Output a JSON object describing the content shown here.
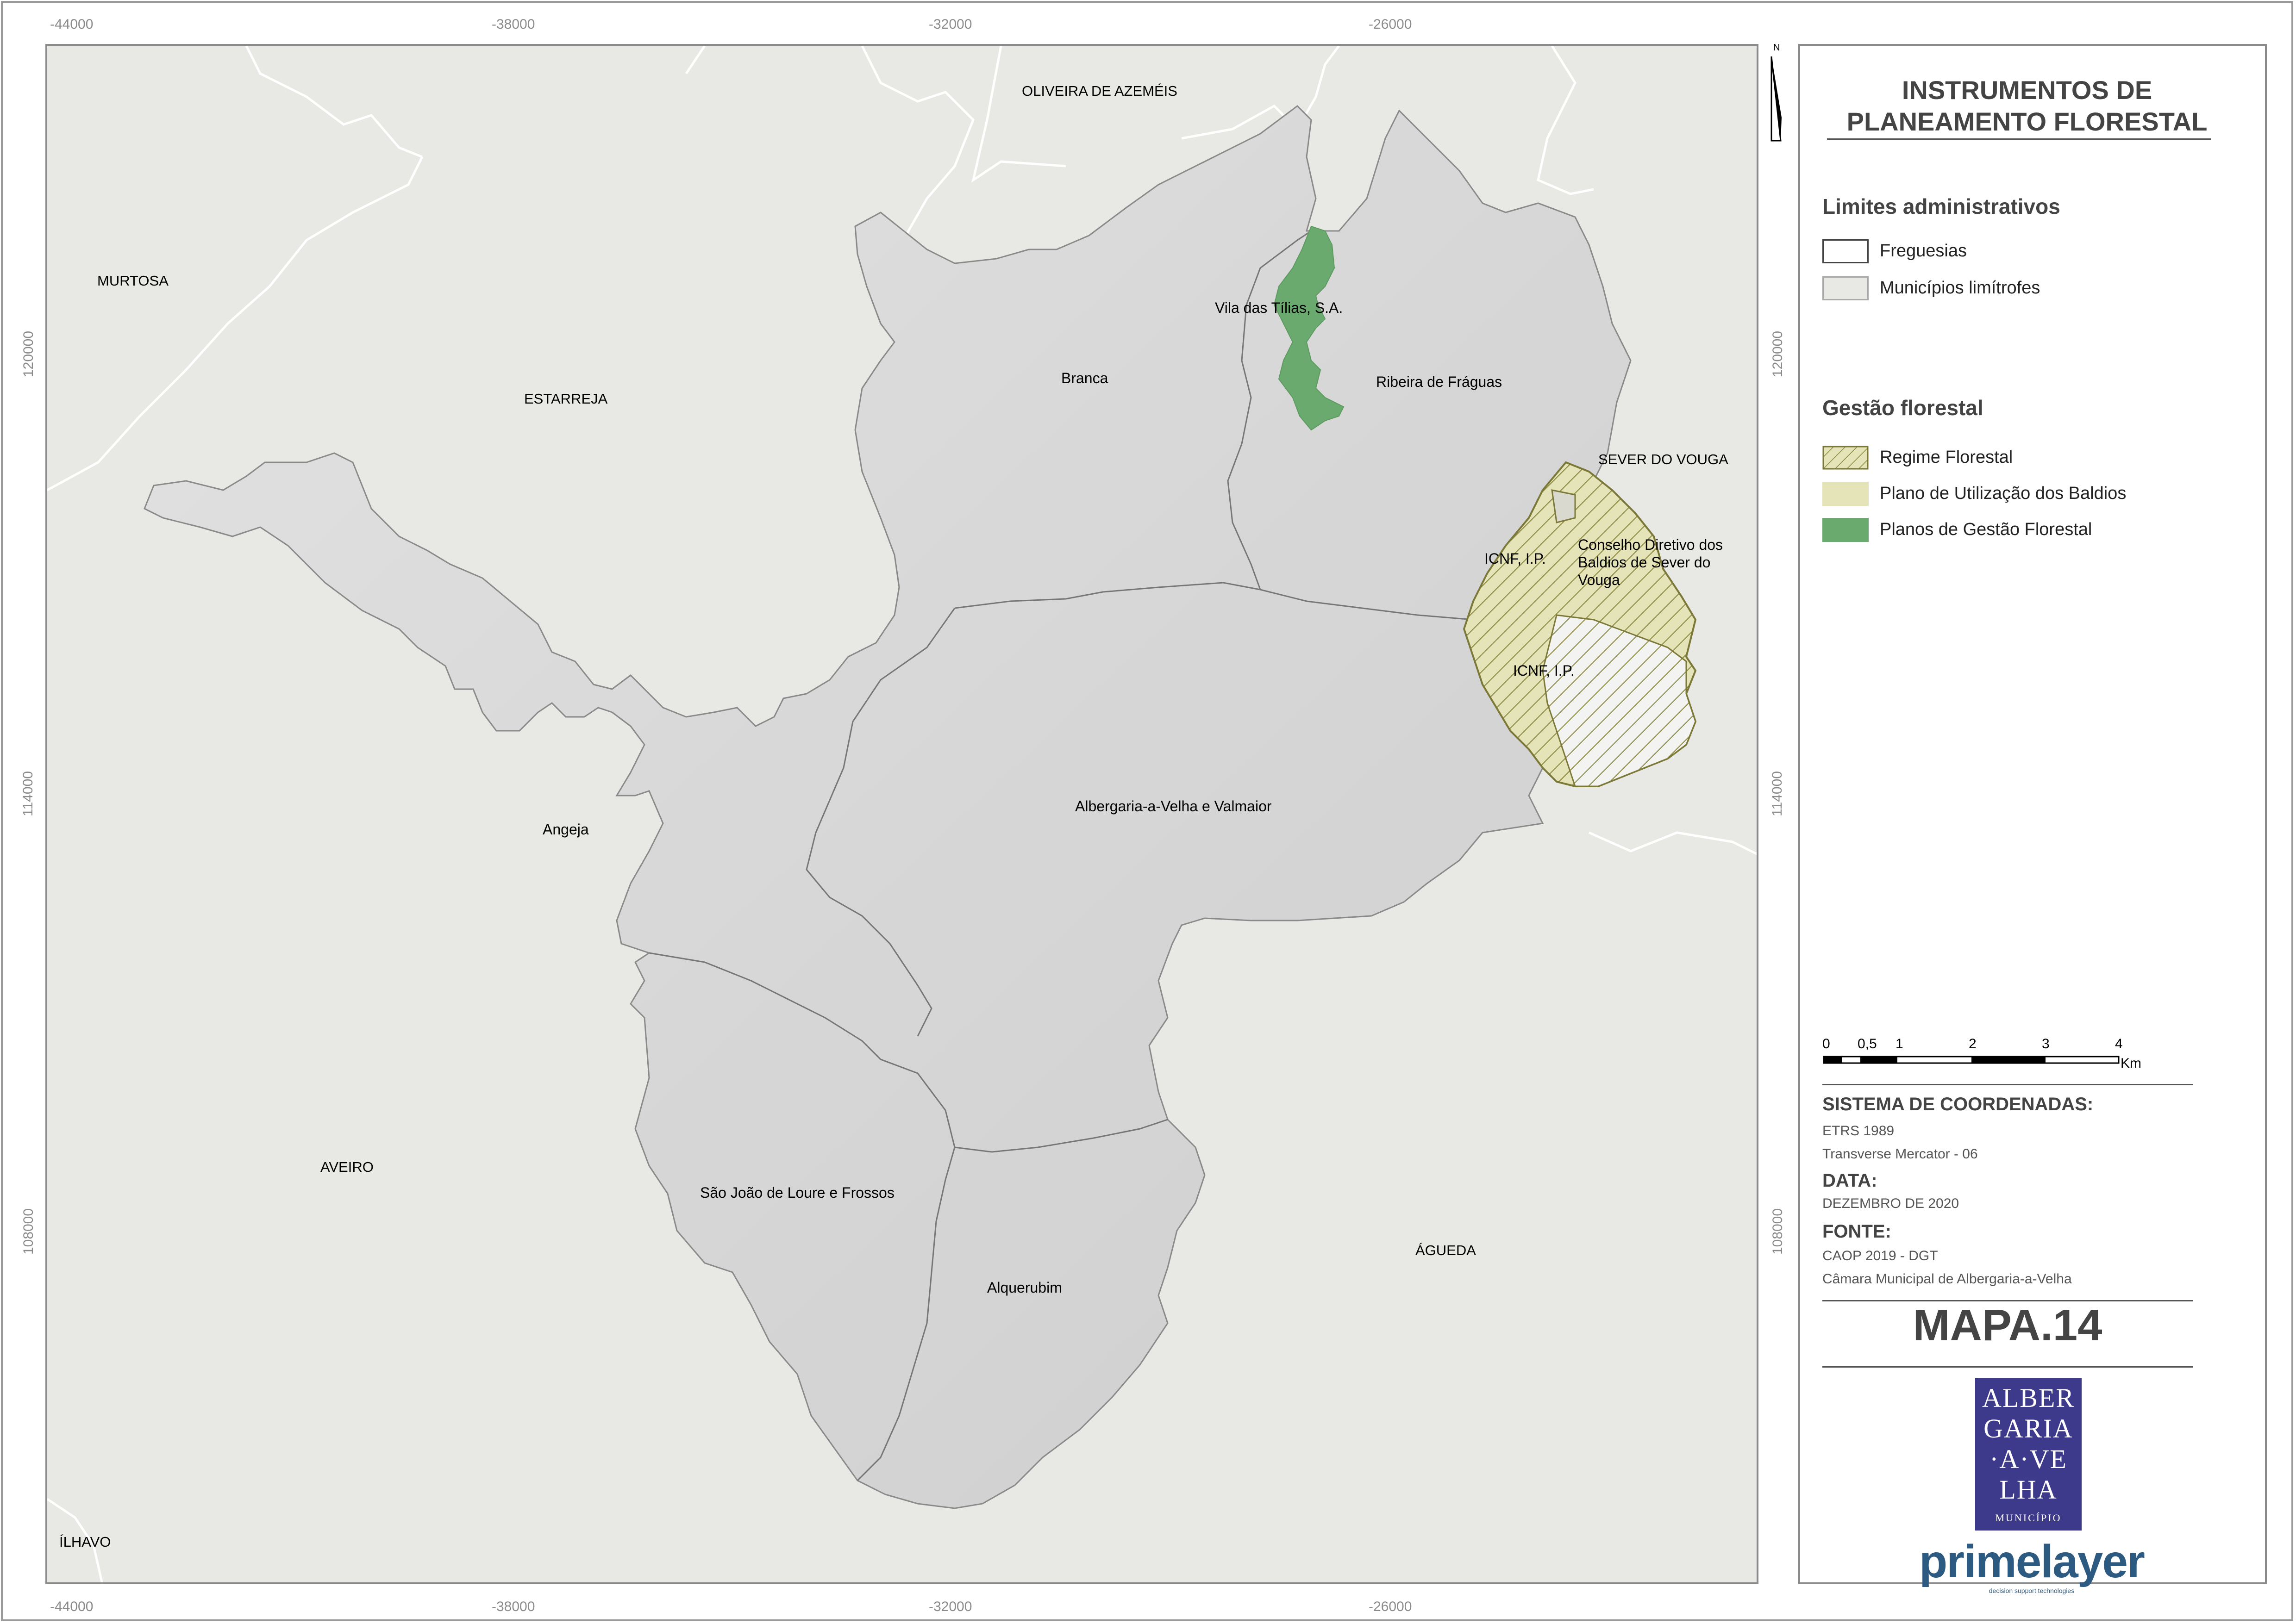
{
  "title": {
    "line1": "INSTRUMENTOS DE",
    "line2": "PLANEAMENTO FLORESTAL"
  },
  "north_arrow_letter": "N",
  "coordinates": {
    "x_ticks": [
      "-44000",
      "-38000",
      "-32000",
      "-26000"
    ],
    "y_ticks": [
      "120000",
      "114000",
      "108000"
    ]
  },
  "map_labels": {
    "oliveira": "OLIVEIRA DE AZEMÉIS",
    "murtosa": "MURTOSA",
    "estarreja": "ESTARREJA",
    "sever": "SEVER DO VOUGA",
    "aveiro": "AVEIRO",
    "agueda": "ÁGUEDA",
    "ilhavo": "ÍLHAVO",
    "branca": "Branca",
    "ribeira": "Ribeira de Fráguas",
    "vila_tilias": "Vila das Tílias, S.A.",
    "icnf1": "ICNF, I.P.",
    "icnf2": "ICNF, I.P.",
    "conselho1": "Conselho Diretivo dos",
    "conselho2": "Baldios de Sever do",
    "conselho3": "Vouga",
    "angeja": "Angeja",
    "albergaria": "Albergaria-a-Velha e Valmaior",
    "sao_joao": "São João de Loure e Frossos",
    "alquerubim": "Alquerubim"
  },
  "legend": {
    "admin_title": "Limites administrativos",
    "freguesias": "Freguesias",
    "municipios": "Municípios limítrofes",
    "gestao_title": "Gestão florestal",
    "regime": "Regime Florestal",
    "plano_baldios": "Plano de Utilização dos Baldios",
    "planos_gestao": "Planos de Gestão Florestal",
    "colors": {
      "freguesias": "#ffffff",
      "municipios": "#e8e9e4",
      "regime_hatch": "#8a8740",
      "plano_baldios": "#e5e3b8",
      "planos_gestao": "#6aaa6e"
    }
  },
  "scale": {
    "labels": [
      "0",
      "0,5",
      "1",
      "2",
      "3",
      "4"
    ],
    "unit": "Km"
  },
  "info": {
    "coord_heading": "SISTEMA DE COORDENADAS:",
    "coord_line1": "ETRS 1989",
    "coord_line2": "Transverse Mercator - 06",
    "date_heading": "DATA:",
    "date_value": "DEZEMBRO DE 2020",
    "source_heading": "FONTE:",
    "source_line1": "CAOP 2019 - DGT",
    "source_line2": "Câmara Municipal de Albergaria-a-Velha"
  },
  "map_id": "MAPA.14",
  "logo": {
    "lines": [
      "ALBER",
      "GARIA",
      "·A·VE",
      "LHA"
    ],
    "sub": "MUNICÍPIO"
  },
  "brand": {
    "name": "primelayer",
    "tagline": "decision support technologies"
  }
}
